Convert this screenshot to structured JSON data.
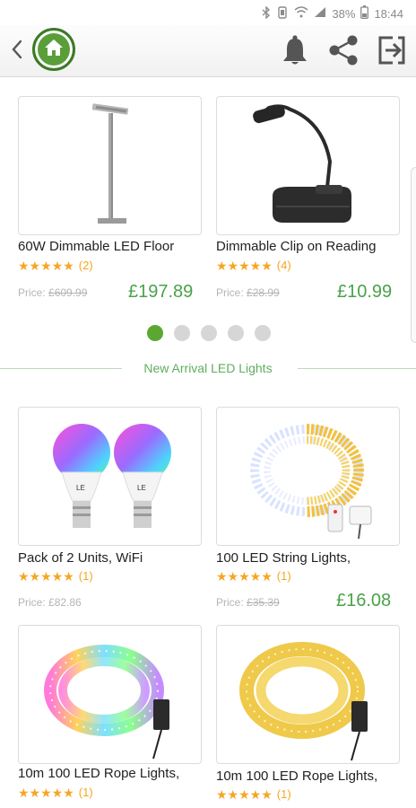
{
  "status_bar": {
    "battery": "38%",
    "time": "18:44"
  },
  "section": {
    "title": "New Arrival LED Lights"
  },
  "carousel": {
    "pages": 5,
    "active": 0
  },
  "products_top": [
    {
      "title": "60W Dimmable LED Floor",
      "stars": 5,
      "reviews": "(2)",
      "price_label": "Price:",
      "old_price": "£609.99",
      "new_price": "£197.89",
      "image": "floor-lamp-image"
    },
    {
      "title": "Dimmable Clip on Reading",
      "stars": 5,
      "reviews": "(4)",
      "price_label": "Price:",
      "old_price": "£28.99",
      "new_price": "£10.99",
      "image": "clip-lamp-image"
    }
  ],
  "products_new": [
    {
      "title": "Pack of 2 Units, WiFi",
      "stars": 5,
      "reviews": "(1)",
      "price_label": "Price:",
      "old_price": "£82.86",
      "image": "rgb-bulbs-image"
    },
    {
      "title": "100 LED String Lights,",
      "stars": 5,
      "reviews": "(1)",
      "price_label": "Price:",
      "old_price": "£35.39",
      "new_price": "£16.08",
      "image": "string-lights-image"
    },
    {
      "title": "10m 100 LED Rope Lights,",
      "stars": 5,
      "reviews": "(1)",
      "image": "multicolor-rope-lights-image"
    },
    {
      "title": "10m 100 LED Rope Lights,",
      "stars": 5,
      "reviews": "(1)",
      "image": "warm-rope-lights-image"
    }
  ],
  "bulb_label": "LE",
  "colors": {
    "accent": "#5aa832",
    "price": "#4aa24a",
    "star": "#f5a623"
  }
}
